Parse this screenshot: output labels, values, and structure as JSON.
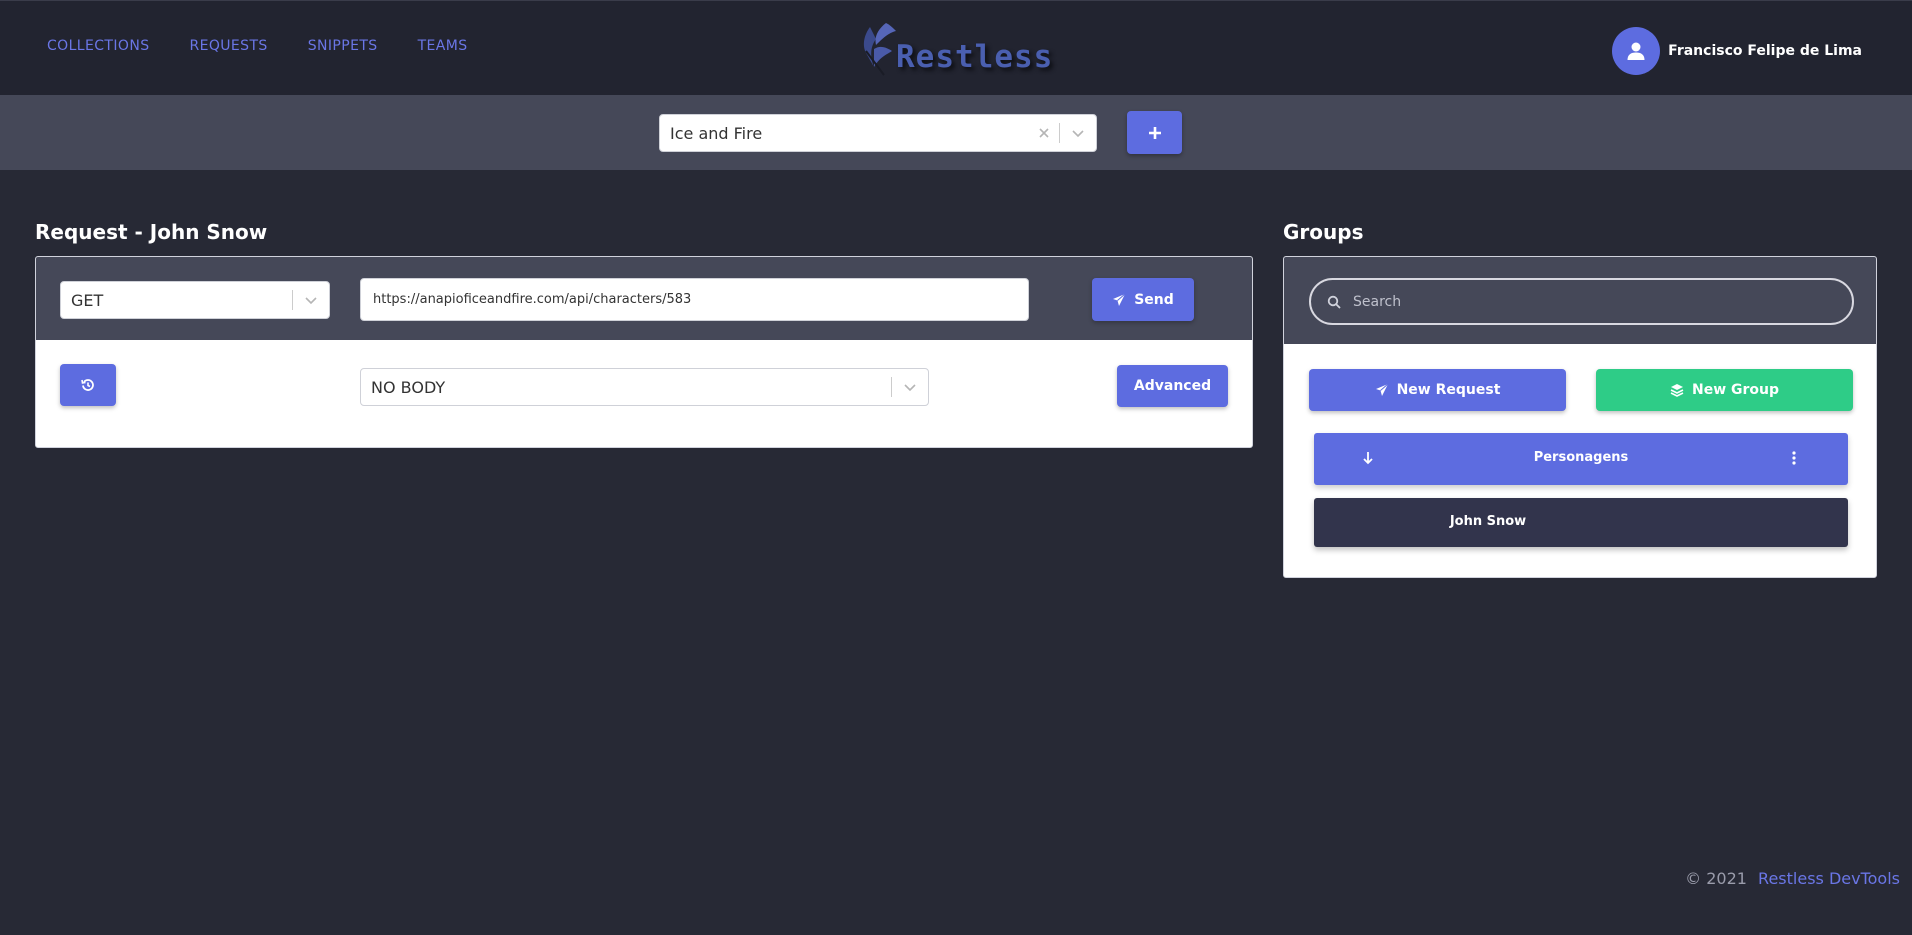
{
  "nav": {
    "items": [
      "COLLECTIONS",
      "REQUESTS",
      "SNIPPETS",
      "TEAMS"
    ]
  },
  "logo": {
    "text": "Restless",
    "icon": "feather-logo-icon"
  },
  "user": {
    "name": "Francisco Felipe de Lima",
    "icon": "user-icon"
  },
  "collection": {
    "selected": "Ice and Fire",
    "add_icon": "plus-icon"
  },
  "request": {
    "title": "Request - John Snow",
    "method": "GET",
    "url": "https://anapioficeandfire.com/api/characters/583",
    "send_label": "Send",
    "body_type": "NO BODY",
    "advanced_label": "Advanced",
    "history_icon": "history-icon"
  },
  "groups": {
    "title": "Groups",
    "search_placeholder": "Search",
    "new_request_label": "New Request",
    "new_group_label": "New Group",
    "items": [
      {
        "name": "Personagens",
        "requests": [
          "John Snow"
        ]
      }
    ]
  },
  "footer": {
    "copyright": "© 2021",
    "brand": "Restless DevTools"
  },
  "colors": {
    "accent": "#5d6ce0",
    "success": "#2ecc87",
    "background": "#272935",
    "nav_link": "#6a76e6"
  }
}
